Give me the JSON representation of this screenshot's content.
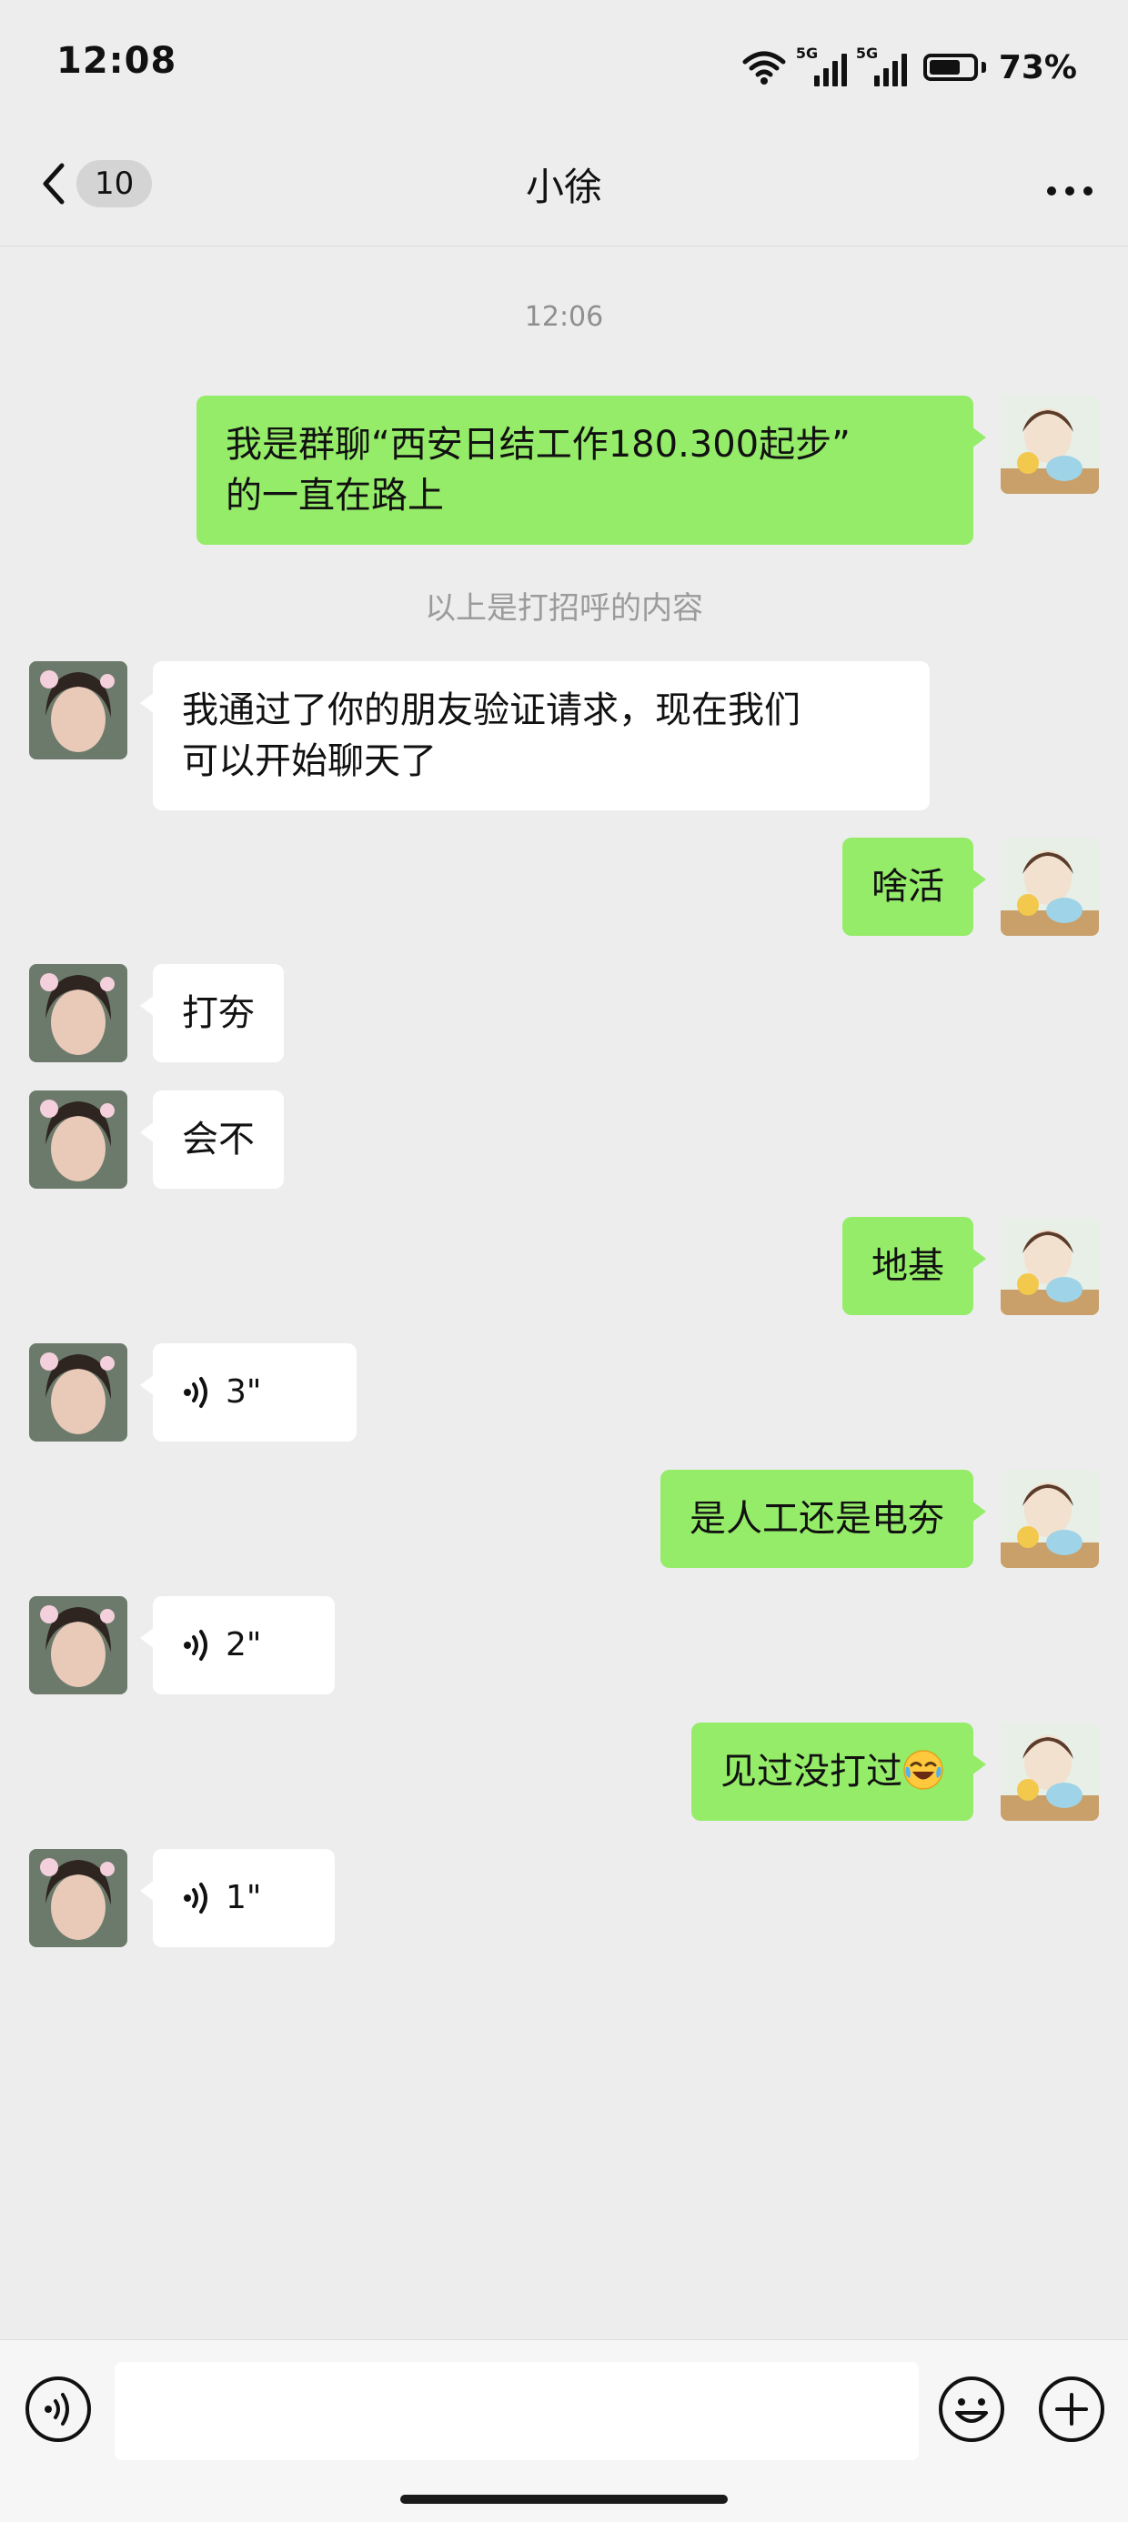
{
  "status_bar": {
    "time": "12:08",
    "network_1": "5G",
    "network_2": "5G",
    "battery_text": "73%",
    "battery_level": 0.73
  },
  "nav": {
    "unread_count": "10",
    "title": "小徐",
    "back_icon": "chevron-left-icon",
    "more_icon": "more-dots-icon"
  },
  "chat": {
    "timestamp": "12:06",
    "system_note": "以上是打招呼的内容",
    "messages": [
      {
        "side": "right",
        "type": "text",
        "line1": "我是群聊“西安日结工作180.300起步”",
        "line2": "的一直在路上"
      },
      {
        "side": "left",
        "type": "text",
        "line1": "我通过了你的朋友验证请求，现在我们",
        "line2": "可以开始聊天了"
      },
      {
        "side": "right",
        "type": "text",
        "text": "啥活"
      },
      {
        "side": "left",
        "type": "text",
        "text": "打夯"
      },
      {
        "side": "left",
        "type": "text",
        "text": "会不"
      },
      {
        "side": "right",
        "type": "text",
        "text": "地基"
      },
      {
        "side": "left",
        "type": "voice",
        "duration": "3\""
      },
      {
        "side": "right",
        "type": "text",
        "text": "是人工还是电夯"
      },
      {
        "side": "left",
        "type": "voice",
        "duration": "2\""
      },
      {
        "side": "right",
        "type": "text",
        "text": "见过没打过",
        "emoji": "laughing-crying-emoji"
      },
      {
        "side": "left",
        "type": "voice",
        "duration": "1\""
      }
    ]
  },
  "composer": {
    "voice_icon": "voice-input-icon",
    "emoji_icon": "emoji-icon",
    "plus_icon": "plus-circle-icon",
    "input_value": ""
  },
  "colors": {
    "background": "#ededed",
    "sent_bubble": "#95ec69",
    "received_bubble": "#ffffff",
    "composer": "#f6f6f6"
  }
}
